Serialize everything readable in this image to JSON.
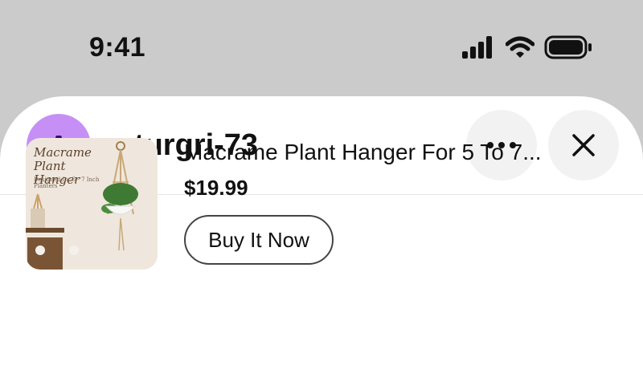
{
  "status_bar": {
    "time": "9:41",
    "icons": [
      "signal-icon",
      "wifi-icon",
      "battery-icon"
    ]
  },
  "header": {
    "avatar_letter": "A",
    "avatar_color": "#c68ff5",
    "username": "arturgri-73",
    "more_icon": "more-horizontal-icon",
    "close_icon": "close-icon"
  },
  "product": {
    "image_title": "Macrame Plant Hanger",
    "image_subtitle": "Designed for 5 - 7 Inch Planters",
    "title": "Macrame Plant Hanger For 5 To 7...",
    "price": "$19.99",
    "buy_label": "Buy It Now"
  }
}
